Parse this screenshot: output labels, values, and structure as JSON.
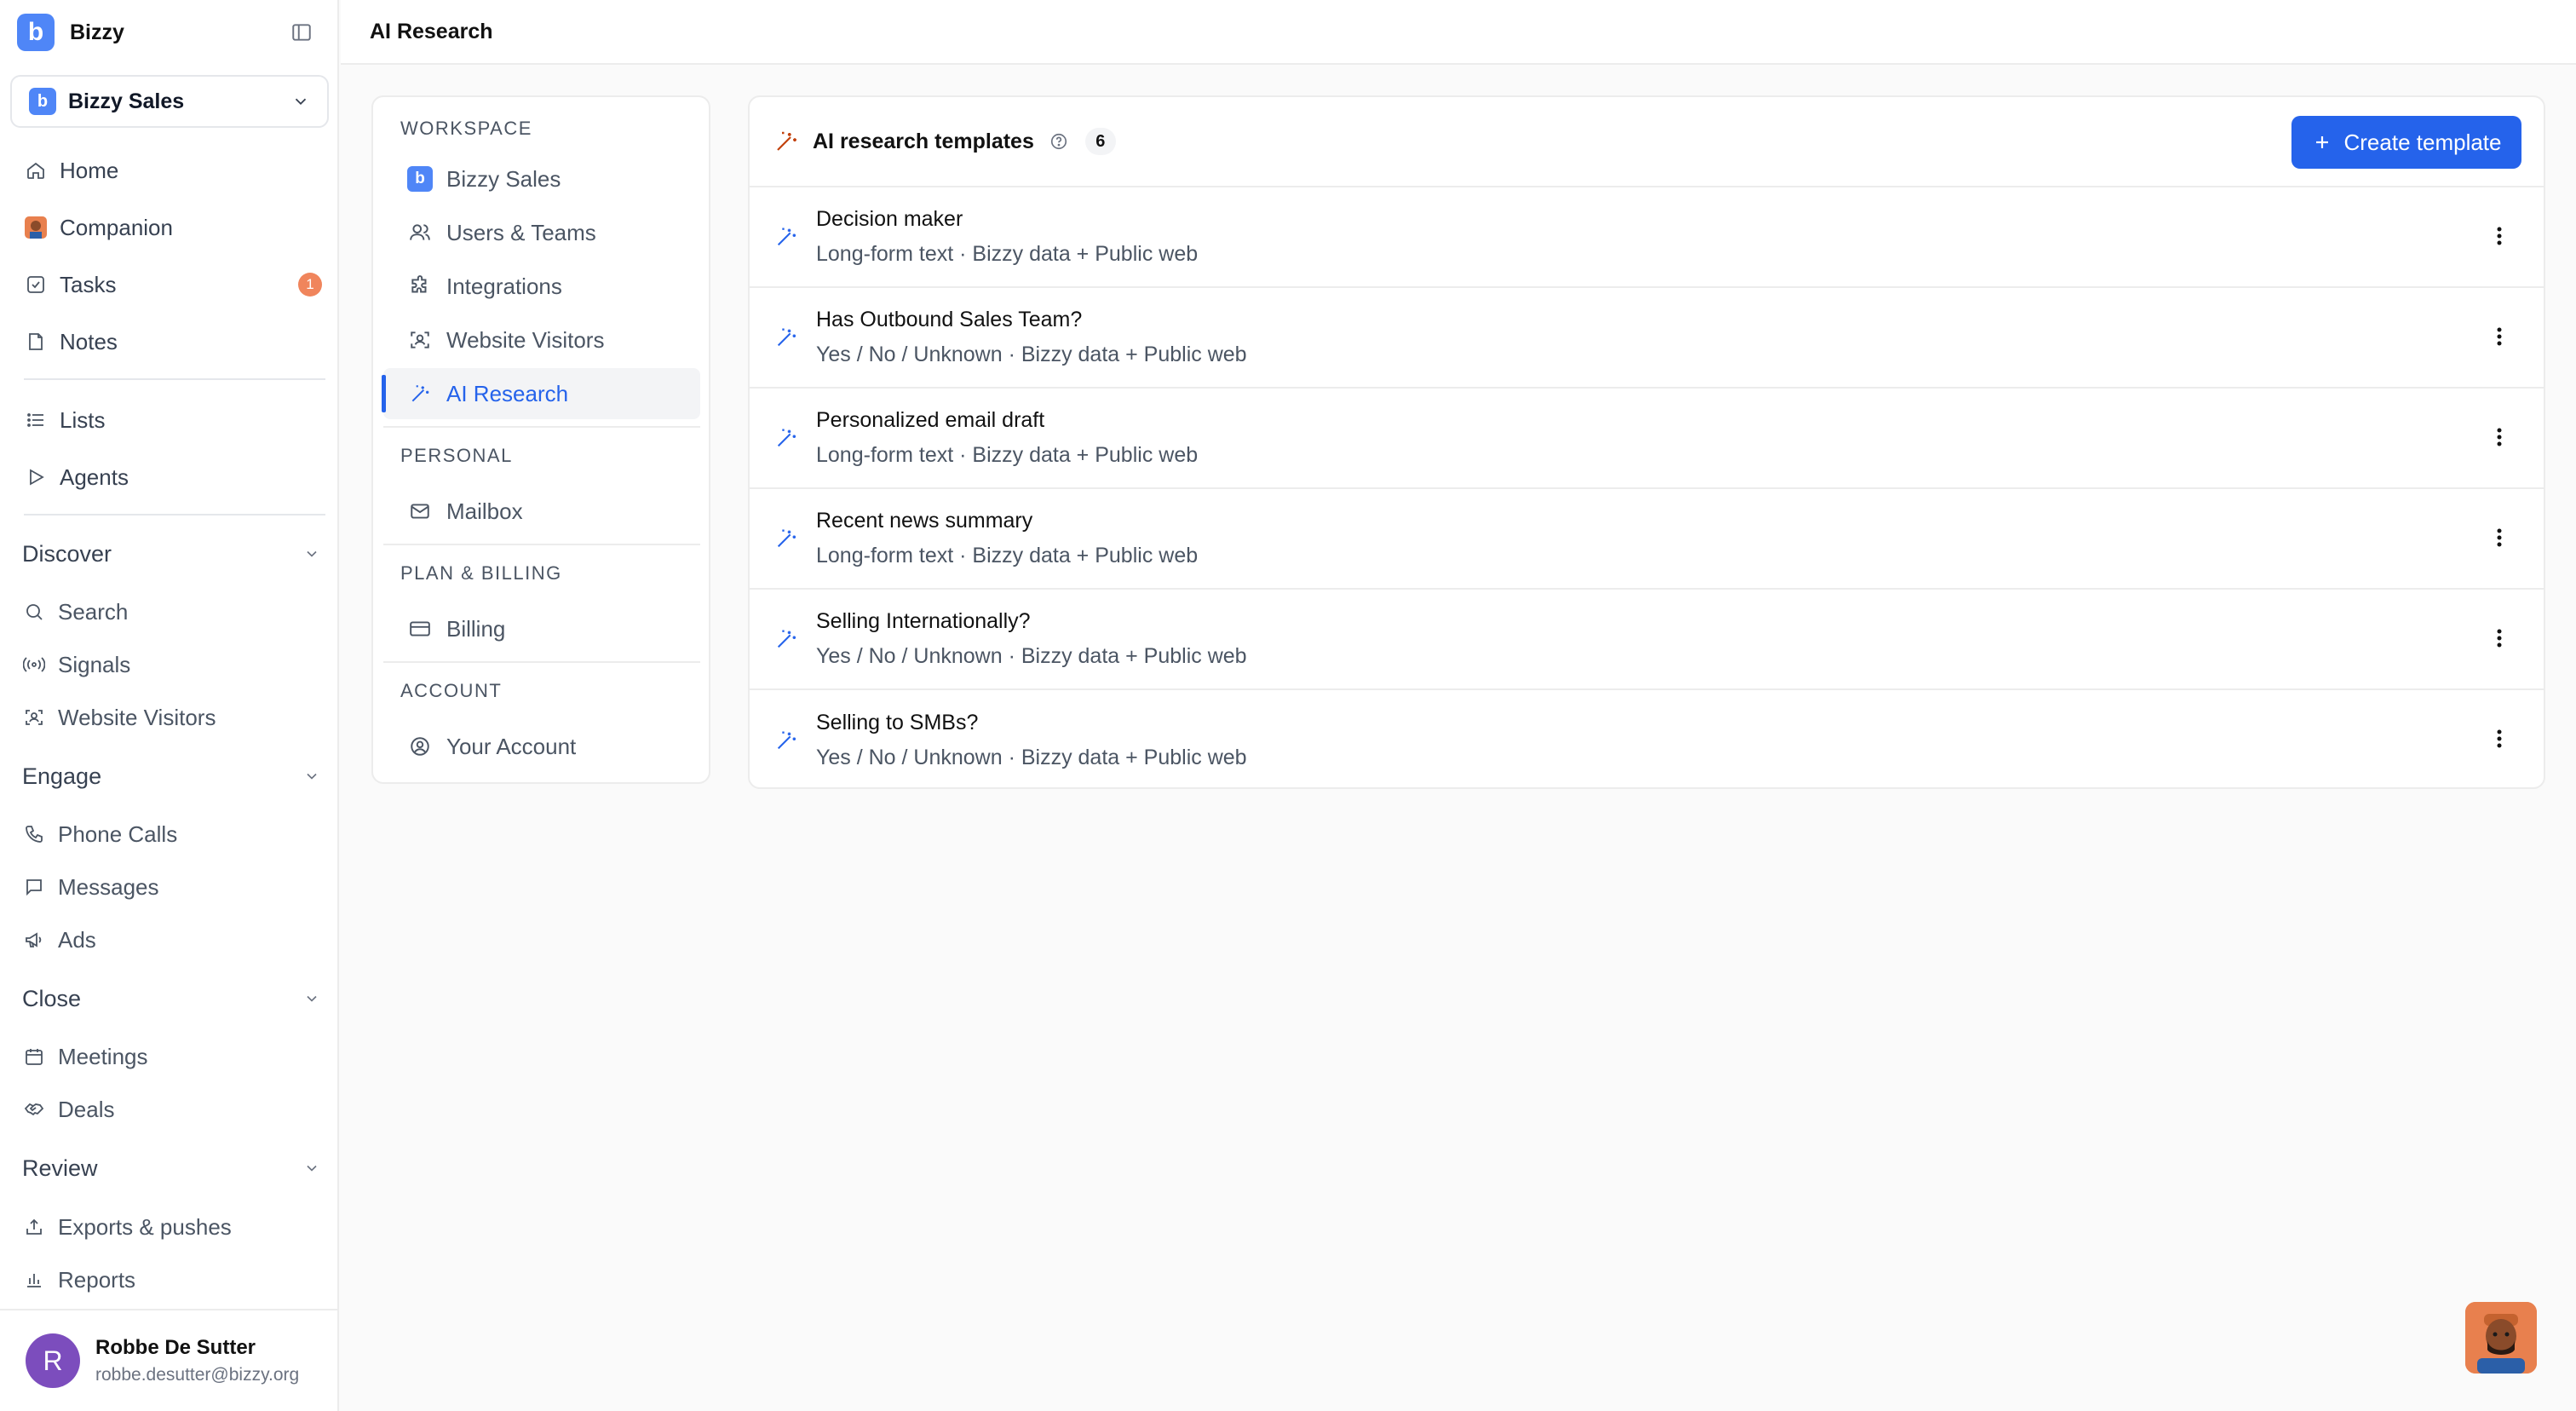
{
  "app": {
    "name": "Bizzy",
    "logo_letter": "b"
  },
  "workspace": {
    "name": "Bizzy Sales",
    "logo_letter": "b"
  },
  "sidebar": {
    "primary": [
      {
        "label": "Home",
        "icon": "home-icon"
      },
      {
        "label": "Companion",
        "icon": "companion-avatar-icon"
      },
      {
        "label": "Tasks",
        "icon": "checkbox-icon",
        "badge": "1"
      },
      {
        "label": "Notes",
        "icon": "note-icon"
      }
    ],
    "secondary": [
      {
        "label": "Lists",
        "icon": "list-icon"
      },
      {
        "label": "Agents",
        "icon": "play-icon"
      }
    ],
    "sections": {
      "discover": {
        "label": "Discover",
        "items": [
          "Search",
          "Signals",
          "Website Visitors"
        ]
      },
      "engage": {
        "label": "Engage",
        "items": [
          "Phone Calls",
          "Messages",
          "Ads"
        ]
      },
      "close": {
        "label": "Close",
        "items": [
          "Meetings",
          "Deals"
        ]
      },
      "review": {
        "label": "Review",
        "items": [
          "Exports & pushes",
          "Reports"
        ]
      }
    }
  },
  "user": {
    "initial": "R",
    "name": "Robbe De Sutter",
    "email": "robbe.desutter@bizzy.org"
  },
  "topbar": {
    "title": "AI Research"
  },
  "settings_nav": {
    "workspace_label": "WORKSPACE",
    "workspace_items": [
      "Bizzy Sales",
      "Users & Teams",
      "Integrations",
      "Website Visitors",
      "AI Research"
    ],
    "active": "AI Research",
    "personal_label": "PERSONAL",
    "personal_items": [
      "Mailbox"
    ],
    "billing_label": "PLAN & BILLING",
    "billing_items": [
      "Billing"
    ],
    "account_label": "ACCOUNT",
    "account_items": [
      "Your Account"
    ]
  },
  "templates": {
    "title": "AI research templates",
    "count": "6",
    "create_label": "Create template",
    "rows": [
      {
        "title": "Decision maker",
        "subtitle": "Long-form text · Bizzy data + Public web"
      },
      {
        "title": "Has Outbound Sales Team?",
        "subtitle": "Yes / No / Unknown · Bizzy data + Public web"
      },
      {
        "title": "Personalized email draft",
        "subtitle": "Long-form text · Bizzy data + Public web"
      },
      {
        "title": "Recent news summary",
        "subtitle": "Long-form text · Bizzy data + Public web"
      },
      {
        "title": "Selling Internationally?",
        "subtitle": "Yes / No / Unknown · Bizzy data + Public web"
      },
      {
        "title": "Selling to SMBs?",
        "subtitle": "Yes / No / Unknown · Bizzy data + Public web"
      }
    ]
  },
  "colors": {
    "accent": "#2563eb",
    "brand": "#4f86f7",
    "badge": "#f0855c",
    "avatar": "#7c4dbd"
  }
}
